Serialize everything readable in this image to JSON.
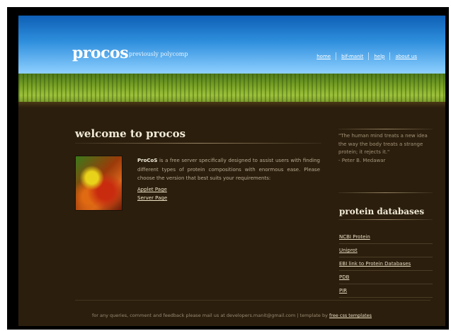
{
  "header": {
    "logo": "procos",
    "logo_sub": "previously polycomp",
    "nav": [
      "home",
      "bif-manit",
      "help",
      "about us"
    ]
  },
  "main": {
    "title": "welcome to procos",
    "desc_bold": "ProCoS",
    "desc": " is a free server specifically designed to assist users with finding different types of protein compositions with enormous ease. Please choose the version that best suits your requirements:",
    "links": [
      "Applet Page",
      "Server Page"
    ]
  },
  "sidebar": {
    "quote": "\"The human mind treats a new idea the way the body treats a strange protein; it rejects it.\"",
    "quote_author": "- Peter B. Medawar",
    "title": "protein databases",
    "databases": [
      "NCBI Protein",
      "Uniprot",
      "EBI link to Protein Databases",
      "PDB",
      "PIR"
    ]
  },
  "footer": {
    "text": "for any queries, comment and feedback please mail us at developers.manit@gmail.com | template by ",
    "link": "free css templates"
  },
  "colors": {
    "background": "#2b1e0d",
    "sky": "#2f8fdd",
    "grass": "#7aa326",
    "heading": "#f2ead8",
    "body_text": "#b9ab90"
  },
  "icons": {
    "thumbnail": "protein-image"
  }
}
